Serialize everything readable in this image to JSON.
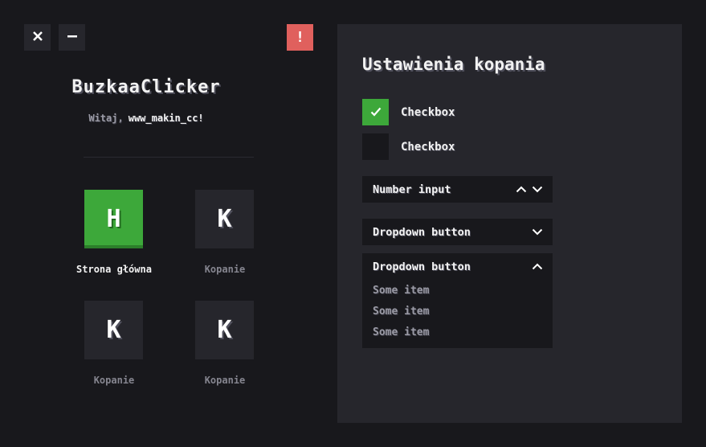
{
  "window": {
    "close_icon": "close-icon",
    "minimize_icon": "minimize-icon",
    "alert_label": "!"
  },
  "app": {
    "title": "BuzkaaClicker",
    "welcome_label": "Witaj,",
    "username": "www_makin_cc!"
  },
  "nav": {
    "tiles": [
      {
        "letter": "H",
        "label": "Strona główna",
        "active": true
      },
      {
        "letter": "K",
        "label": "Kopanie",
        "active": false
      },
      {
        "letter": "K",
        "label": "Kopanie",
        "active": false
      },
      {
        "letter": "K",
        "label": "Kopanie",
        "active": false
      }
    ]
  },
  "settings": {
    "title": "Ustawienia kopania",
    "checkboxes": [
      {
        "label": "Checkbox",
        "checked": true
      },
      {
        "label": "Checkbox",
        "checked": false
      }
    ],
    "number_input": {
      "label": "Number input"
    },
    "dropdown_closed": {
      "label": "Dropdown button"
    },
    "dropdown_open": {
      "label": "Dropdown button",
      "items": [
        "Some item",
        "Some item",
        "Some item"
      ]
    }
  },
  "colors": {
    "accent": "#3da83a",
    "alert": "#e0605d",
    "background": "#18181c",
    "panel": "#26262c"
  }
}
